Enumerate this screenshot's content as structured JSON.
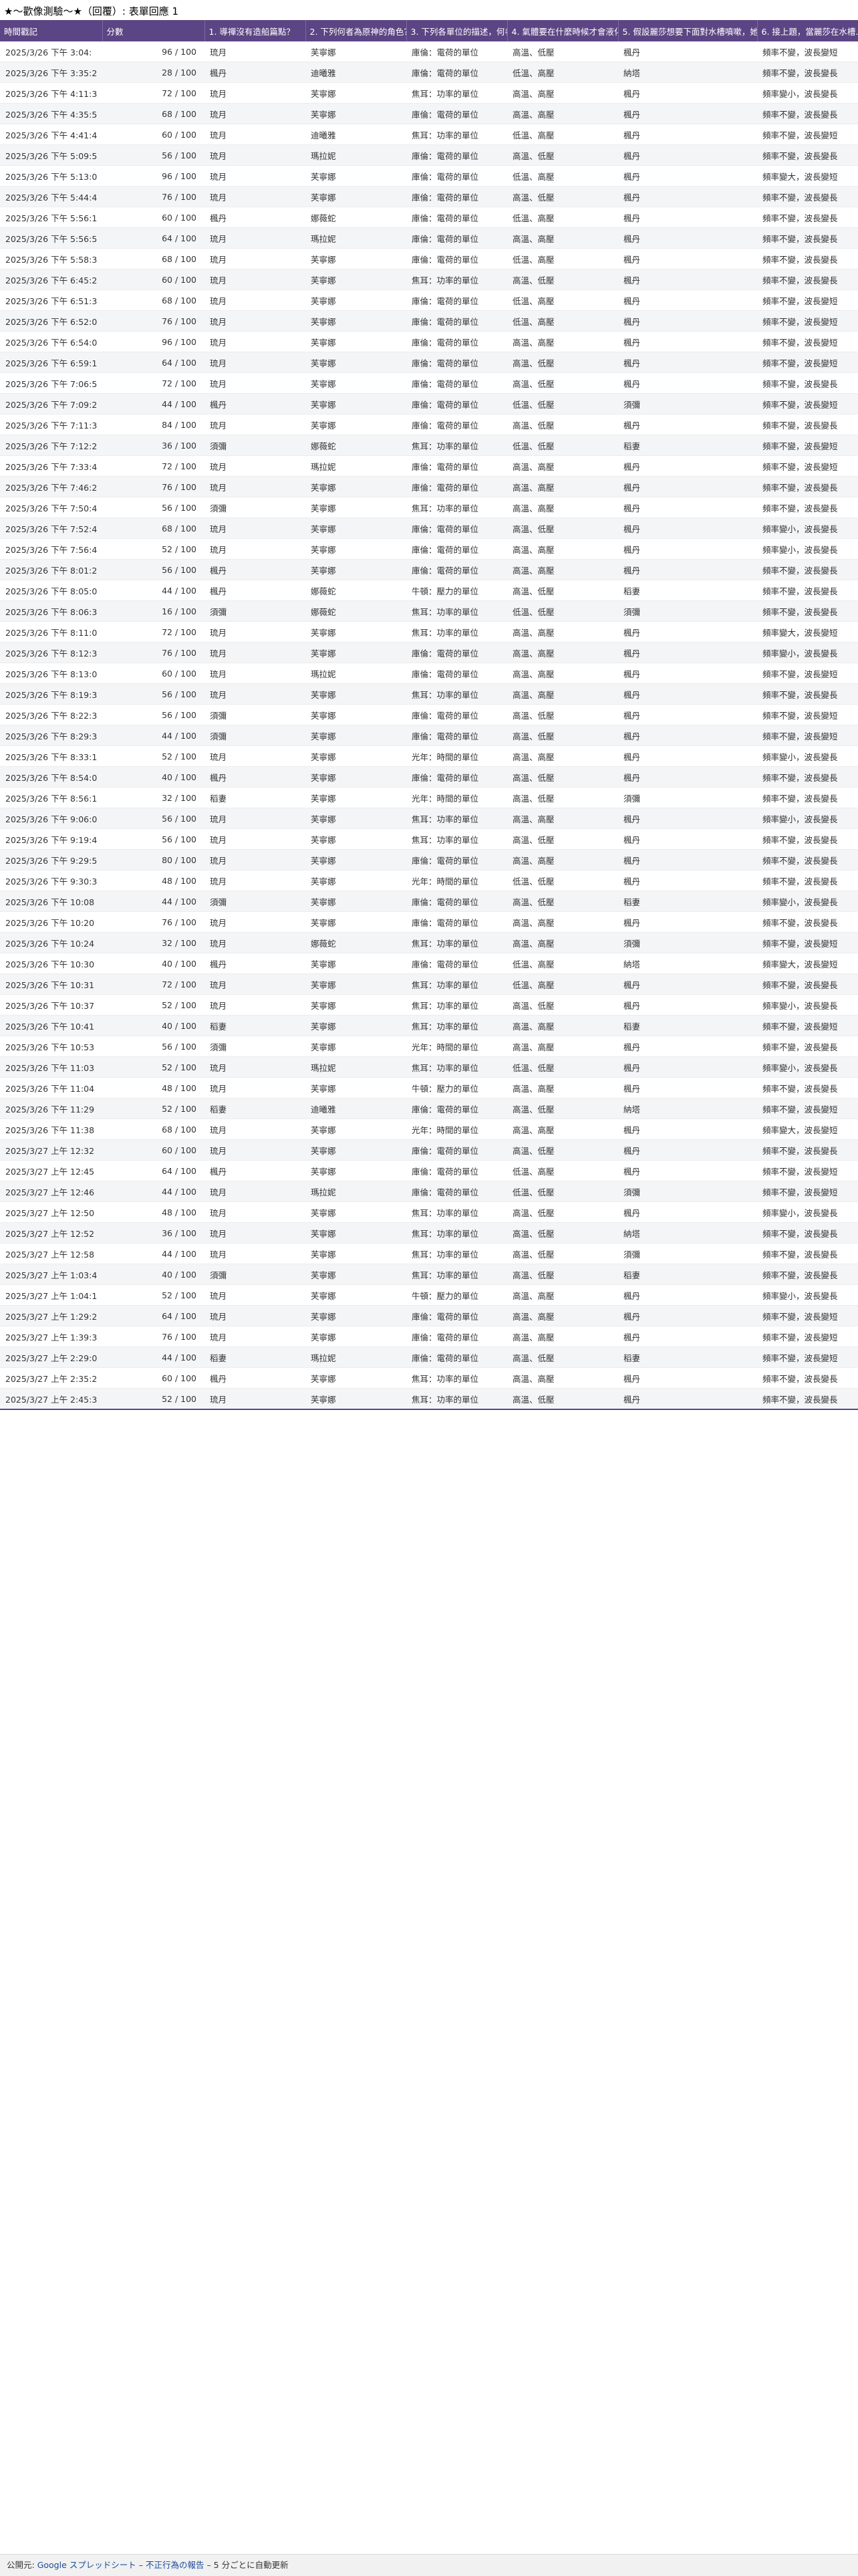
{
  "page_title": "★〜歡像測驗〜★（回覆）: 表單回應 1",
  "columns": [
    "時間戳記",
    "分數",
    "1. 導禪沒有造船篇點？",
    "2. 下列何者為原神的角色？",
    "3. 下列各單位的描述，何者正確？",
    "4. 氣體要在什麼時候才會液化？",
    "5. 假設麗莎想要下面對水槽噴嗽，她該使用…",
    "6. 接上題，當麗莎在水槽…"
  ],
  "rows": [
    [
      "2025/3/26 下午 3:04:",
      "96 / 100",
      "琉月",
      "芙寧娜",
      "庫倫：電荷的單位",
      "高溫、低壓",
      "楓丹",
      "頻率不變，波長變短"
    ],
    [
      "2025/3/26 下午 3:35:2",
      "28 / 100",
      "楓丹",
      "迪曦雅",
      "庫倫：電荷的單位",
      "低溫、高壓",
      "納塔",
      "頻率不變，波長變長"
    ],
    [
      "2025/3/26 下午 4:11:3",
      "72 / 100",
      "琉月",
      "芙寧娜",
      "焦耳：功率的單位",
      "高溫、高壓",
      "楓丹",
      "頻率變小，波長變長"
    ],
    [
      "2025/3/26 下午 4:35:5",
      "68 / 100",
      "琉月",
      "芙寧娜",
      "庫倫：電荷的單位",
      "高溫、高壓",
      "楓丹",
      "頻率不變，波長變長"
    ],
    [
      "2025/3/26 下午 4:41:4",
      "60 / 100",
      "琉月",
      "迪曦雅",
      "焦耳：功率的單位",
      "低溫、高壓",
      "楓丹",
      "頻率不變，波長變短"
    ],
    [
      "2025/3/26 下午 5:09:5",
      "56 / 100",
      "琉月",
      "瑪拉妮",
      "庫倫：電荷的單位",
      "高溫、低壓",
      "楓丹",
      "頻率不變，波長變長"
    ],
    [
      "2025/3/26 下午 5:13:0",
      "96 / 100",
      "琉月",
      "芙寧娜",
      "庫倫：電荷的單位",
      "低溫、高壓",
      "楓丹",
      "頻率變大，波長變短"
    ],
    [
      "2025/3/26 下午 5:44:4",
      "76 / 100",
      "琉月",
      "芙寧娜",
      "庫倫：電荷的單位",
      "高溫、低壓",
      "楓丹",
      "頻率不變，波長變長"
    ],
    [
      "2025/3/26 下午 5:56:1",
      "60 / 100",
      "楓丹",
      "娜薇蛇",
      "庫倫：電荷的單位",
      "低溫、高壓",
      "楓丹",
      "頻率不變，波長變長"
    ],
    [
      "2025/3/26 下午 5:56:5",
      "64 / 100",
      "琉月",
      "瑪拉妮",
      "庫倫：電荷的單位",
      "高溫、高壓",
      "楓丹",
      "頻率不變，波長變長"
    ],
    [
      "2025/3/26 下午 5:58:3",
      "68 / 100",
      "琉月",
      "芙寧娜",
      "庫倫：電荷的單位",
      "低溫、高壓",
      "楓丹",
      "頻率不變，波長變長"
    ],
    [
      "2025/3/26 下午 6:45:2",
      "60 / 100",
      "琉月",
      "芙寧娜",
      "焦耳：功率的單位",
      "高溫、低壓",
      "楓丹",
      "頻率不變，波長變長"
    ],
    [
      "2025/3/26 下午 6:51:3",
      "68 / 100",
      "琉月",
      "芙寧娜",
      "庫倫：電荷的單位",
      "低溫、高壓",
      "楓丹",
      "頻率不變，波長變短"
    ],
    [
      "2025/3/26 下午 6:52:0",
      "76 / 100",
      "琉月",
      "芙寧娜",
      "庫倫：電荷的單位",
      "低溫、高壓",
      "楓丹",
      "頻率不變，波長變短"
    ],
    [
      "2025/3/26 下午 6:54:0",
      "96 / 100",
      "琉月",
      "芙寧娜",
      "庫倫：電荷的單位",
      "高溫、高壓",
      "楓丹",
      "頻率不變，波長變短"
    ],
    [
      "2025/3/26 下午 6:59:1",
      "64 / 100",
      "琉月",
      "芙寧娜",
      "庫倫：電荷的單位",
      "高溫、低壓",
      "楓丹",
      "頻率不變，波長變短"
    ],
    [
      "2025/3/26 下午 7:06:5",
      "72 / 100",
      "琉月",
      "芙寧娜",
      "庫倫：電荷的單位",
      "高溫、低壓",
      "楓丹",
      "頻率不變，波長變長"
    ],
    [
      "2025/3/26 下午 7:09:2",
      "44 / 100",
      "楓丹",
      "芙寧娜",
      "庫倫：電荷的單位",
      "低溫、低壓",
      "須彌",
      "頻率不變，波長變短"
    ],
    [
      "2025/3/26 下午 7:11:3",
      "84 / 100",
      "琉月",
      "芙寧娜",
      "庫倫：電荷的單位",
      "高溫、低壓",
      "楓丹",
      "頻率不變，波長變長"
    ],
    [
      "2025/3/26 下午 7:12:2",
      "36 / 100",
      "須彌",
      "娜薇蛇",
      "焦耳：功率的單位",
      "低溫、低壓",
      "稻妻",
      "頻率不變，波長變短"
    ],
    [
      "2025/3/26 下午 7:33:4",
      "72 / 100",
      "琉月",
      "瑪拉妮",
      "庫倫：電荷的單位",
      "高溫、高壓",
      "楓丹",
      "頻率不變，波長變短"
    ],
    [
      "2025/3/26 下午 7:46:2",
      "76 / 100",
      "琉月",
      "芙寧娜",
      "庫倫：電荷的單位",
      "高溫、高壓",
      "楓丹",
      "頻率不變，波長變長"
    ],
    [
      "2025/3/26 下午 7:50:4",
      "56 / 100",
      "須彌",
      "芙寧娜",
      "焦耳：功率的單位",
      "高溫、高壓",
      "楓丹",
      "頻率不變，波長變長"
    ],
    [
      "2025/3/26 下午 7:52:4",
      "68 / 100",
      "琉月",
      "芙寧娜",
      "庫倫：電荷的單位",
      "高溫、低壓",
      "楓丹",
      "頻率變小，波長變長"
    ],
    [
      "2025/3/26 下午 7:56:4",
      "52 / 100",
      "琉月",
      "芙寧娜",
      "庫倫：電荷的單位",
      "高溫、高壓",
      "楓丹",
      "頻率變小，波長變長"
    ],
    [
      "2025/3/26 下午 8:01:2",
      "56 / 100",
      "楓丹",
      "芙寧娜",
      "庫倫：電荷的單位",
      "高溫、高壓",
      "楓丹",
      "頻率不變，波長變長"
    ],
    [
      "2025/3/26 下午 8:05:0",
      "44 / 100",
      "楓丹",
      "娜薇蛇",
      "牛頓：壓力的單位",
      "高溫、低壓",
      "稻妻",
      "頻率不變，波長變長"
    ],
    [
      "2025/3/26 下午 8:06:3",
      "16 / 100",
      "須彌",
      "娜薇蛇",
      "焦耳：功率的單位",
      "低溫、低壓",
      "須彌",
      "頻率不變，波長變長"
    ],
    [
      "2025/3/26 下午 8:11:0",
      "72 / 100",
      "琉月",
      "芙寧娜",
      "焦耳：功率的單位",
      "高溫、高壓",
      "楓丹",
      "頻率變大，波長變短"
    ],
    [
      "2025/3/26 下午 8:12:3",
      "76 / 100",
      "琉月",
      "芙寧娜",
      "庫倫：電荷的單位",
      "高溫、高壓",
      "楓丹",
      "頻率變小，波長變長"
    ],
    [
      "2025/3/26 下午 8:13:0",
      "60 / 100",
      "琉月",
      "瑪拉妮",
      "庫倫：電荷的單位",
      "高溫、高壓",
      "楓丹",
      "頻率不變，波長變短"
    ],
    [
      "2025/3/26 下午 8:19:3",
      "56 / 100",
      "琉月",
      "芙寧娜",
      "焦耳：功率的單位",
      "高溫、高壓",
      "楓丹",
      "頻率不變，波長變長"
    ],
    [
      "2025/3/26 下午 8:22:3",
      "56 / 100",
      "須彌",
      "芙寧娜",
      "庫倫：電荷的單位",
      "高溫、低壓",
      "楓丹",
      "頻率不變，波長變短"
    ],
    [
      "2025/3/26 下午 8:29:3",
      "44 / 100",
      "須彌",
      "芙寧娜",
      "庫倫：電荷的單位",
      "高溫、低壓",
      "楓丹",
      "頻率不變，波長變短"
    ],
    [
      "2025/3/26 下午 8:33:1",
      "52 / 100",
      "琉月",
      "芙寧娜",
      "光年：時間的單位",
      "高溫、高壓",
      "楓丹",
      "頻率變小，波長變長"
    ],
    [
      "2025/3/26 下午 8:54:0",
      "40 / 100",
      "楓丹",
      "芙寧娜",
      "庫倫：電荷的單位",
      "高溫、低壓",
      "楓丹",
      "頻率不變，波長變長"
    ],
    [
      "2025/3/26 下午 8:56:1",
      "32 / 100",
      "稻妻",
      "芙寧娜",
      "光年：時間的單位",
      "高溫、低壓",
      "須彌",
      "頻率不變，波長變長"
    ],
    [
      "2025/3/26 下午 9:06:0",
      "56 / 100",
      "琉月",
      "芙寧娜",
      "焦耳：功率的單位",
      "高溫、高壓",
      "楓丹",
      "頻率變小，波長變長"
    ],
    [
      "2025/3/26 下午 9:19:4",
      "56 / 100",
      "琉月",
      "芙寧娜",
      "焦耳：功率的單位",
      "高溫、低壓",
      "楓丹",
      "頻率不變，波長變長"
    ],
    [
      "2025/3/26 下午 9:29:5",
      "80 / 100",
      "琉月",
      "芙寧娜",
      "庫倫：電荷的單位",
      "高溫、高壓",
      "楓丹",
      "頻率不變，波長變長"
    ],
    [
      "2025/3/26 下午 9:30:3",
      "48 / 100",
      "琉月",
      "芙寧娜",
      "光年：時間的單位",
      "低溫、低壓",
      "楓丹",
      "頻率不變，波長變長"
    ],
    [
      "2025/3/26 下午 10:08",
      "44 / 100",
      "須彌",
      "芙寧娜",
      "庫倫：電荷的單位",
      "高溫、低壓",
      "稻妻",
      "頻率變小，波長變長"
    ],
    [
      "2025/3/26 下午 10:20",
      "76 / 100",
      "琉月",
      "芙寧娜",
      "庫倫：電荷的單位",
      "高溫、高壓",
      "楓丹",
      "頻率不變，波長變長"
    ],
    [
      "2025/3/26 下午 10:24",
      "32 / 100",
      "琉月",
      "娜薇蛇",
      "焦耳：功率的單位",
      "高溫、高壓",
      "須彌",
      "頻率不變，波長變短"
    ],
    [
      "2025/3/26 下午 10:30",
      "40 / 100",
      "楓丹",
      "芙寧娜",
      "庫倫：電荷的單位",
      "低溫、高壓",
      "納塔",
      "頻率變大，波長變短"
    ],
    [
      "2025/3/26 下午 10:31",
      "72 / 100",
      "琉月",
      "芙寧娜",
      "焦耳：功率的單位",
      "低溫、高壓",
      "楓丹",
      "頻率不變，波長變長"
    ],
    [
      "2025/3/26 下午 10:37",
      "52 / 100",
      "琉月",
      "芙寧娜",
      "焦耳：功率的單位",
      "高溫、低壓",
      "楓丹",
      "頻率變小，波長變長"
    ],
    [
      "2025/3/26 下午 10:41",
      "40 / 100",
      "稻妻",
      "芙寧娜",
      "焦耳：功率的單位",
      "高溫、高壓",
      "稻妻",
      "頻率不變，波長變短"
    ],
    [
      "2025/3/26 下午 10:53",
      "56 / 100",
      "須彌",
      "芙寧娜",
      "光年：時間的單位",
      "高溫、高壓",
      "楓丹",
      "頻率不變，波長變長"
    ],
    [
      "2025/3/26 下午 11:03",
      "52 / 100",
      "琉月",
      "瑪拉妮",
      "焦耳：功率的單位",
      "低溫、低壓",
      "楓丹",
      "頻率變小，波長變長"
    ],
    [
      "2025/3/26 下午 11:04",
      "48 / 100",
      "琉月",
      "芙寧娜",
      "牛頓：壓力的單位",
      "高溫、高壓",
      "楓丹",
      "頻率不變，波長變長"
    ],
    [
      "2025/3/26 下午 11:29",
      "52 / 100",
      "稻妻",
      "迪曦雅",
      "庫倫：電荷的單位",
      "高溫、低壓",
      "納塔",
      "頻率不變，波長變短"
    ],
    [
      "2025/3/26 下午 11:38",
      "68 / 100",
      "琉月",
      "芙寧娜",
      "光年：時間的單位",
      "高溫、高壓",
      "楓丹",
      "頻率變大，波長變短"
    ],
    [
      "2025/3/27 上午 12:32",
      "60 / 100",
      "琉月",
      "芙寧娜",
      "庫倫：電荷的單位",
      "高溫、低壓",
      "楓丹",
      "頻率不變，波長變長"
    ],
    [
      "2025/3/27 上午 12:45",
      "64 / 100",
      "楓丹",
      "芙寧娜",
      "庫倫：電荷的單位",
      "低溫、高壓",
      "楓丹",
      "頻率不變，波長變短"
    ],
    [
      "2025/3/27 上午 12:46",
      "44 / 100",
      "琉月",
      "瑪拉妮",
      "庫倫：電荷的單位",
      "低溫、低壓",
      "須彌",
      "頻率不變，波長變短"
    ],
    [
      "2025/3/27 上午 12:50",
      "48 / 100",
      "琉月",
      "芙寧娜",
      "焦耳：功率的單位",
      "高溫、低壓",
      "楓丹",
      "頻率變小，波長變長"
    ],
    [
      "2025/3/27 上午 12:52",
      "36 / 100",
      "琉月",
      "芙寧娜",
      "焦耳：功率的單位",
      "高溫、低壓",
      "納塔",
      "頻率不變，波長變長"
    ],
    [
      "2025/3/27 上午 12:58",
      "44 / 100",
      "琉月",
      "芙寧娜",
      "焦耳：功率的單位",
      "高溫、低壓",
      "須彌",
      "頻率不變，波長變長"
    ],
    [
      "2025/3/27 上午 1:03:4",
      "40 / 100",
      "須彌",
      "芙寧娜",
      "焦耳：功率的單位",
      "高溫、低壓",
      "稻妻",
      "頻率不變，波長變長"
    ],
    [
      "2025/3/27 上午 1:04:1",
      "52 / 100",
      "琉月",
      "芙寧娜",
      "牛頓：壓力的單位",
      "高溫、高壓",
      "楓丹",
      "頻率變小，波長變長"
    ],
    [
      "2025/3/27 上午 1:29:2",
      "64 / 100",
      "琉月",
      "芙寧娜",
      "庫倫：電荷的單位",
      "高溫、高壓",
      "楓丹",
      "頻率不變，波長變短"
    ],
    [
      "2025/3/27 上午 1:39:3",
      "76 / 100",
      "琉月",
      "芙寧娜",
      "庫倫：電荷的單位",
      "高溫、高壓",
      "楓丹",
      "頻率不變，波長變短"
    ],
    [
      "2025/3/27 上午 2:29:0",
      "44 / 100",
      "稻妻",
      "瑪拉妮",
      "庫倫：電荷的單位",
      "高溫、低壓",
      "稻妻",
      "頻率不變，波長變短"
    ],
    [
      "2025/3/27 上午 2:35:2",
      "60 / 100",
      "楓丹",
      "芙寧娜",
      "焦耳：功率的單位",
      "高溫、高壓",
      "楓丹",
      "頻率不變，波長變長"
    ],
    [
      "2025/3/27 上午 2:45:3",
      "52 / 100",
      "琉月",
      "芙寧娜",
      "焦耳：功率的單位",
      "高溫、低壓",
      "楓丹",
      "頻率不變，波長變長"
    ]
  ],
  "footer": {
    "prefix": "公開元: ",
    "sheets_link": "Google スプレッドシート",
    "sep1": " – ",
    "abuse_link": "不正行為の報告",
    "sep2": " – ",
    "auto_update": "5 分ごとに自動更新"
  }
}
